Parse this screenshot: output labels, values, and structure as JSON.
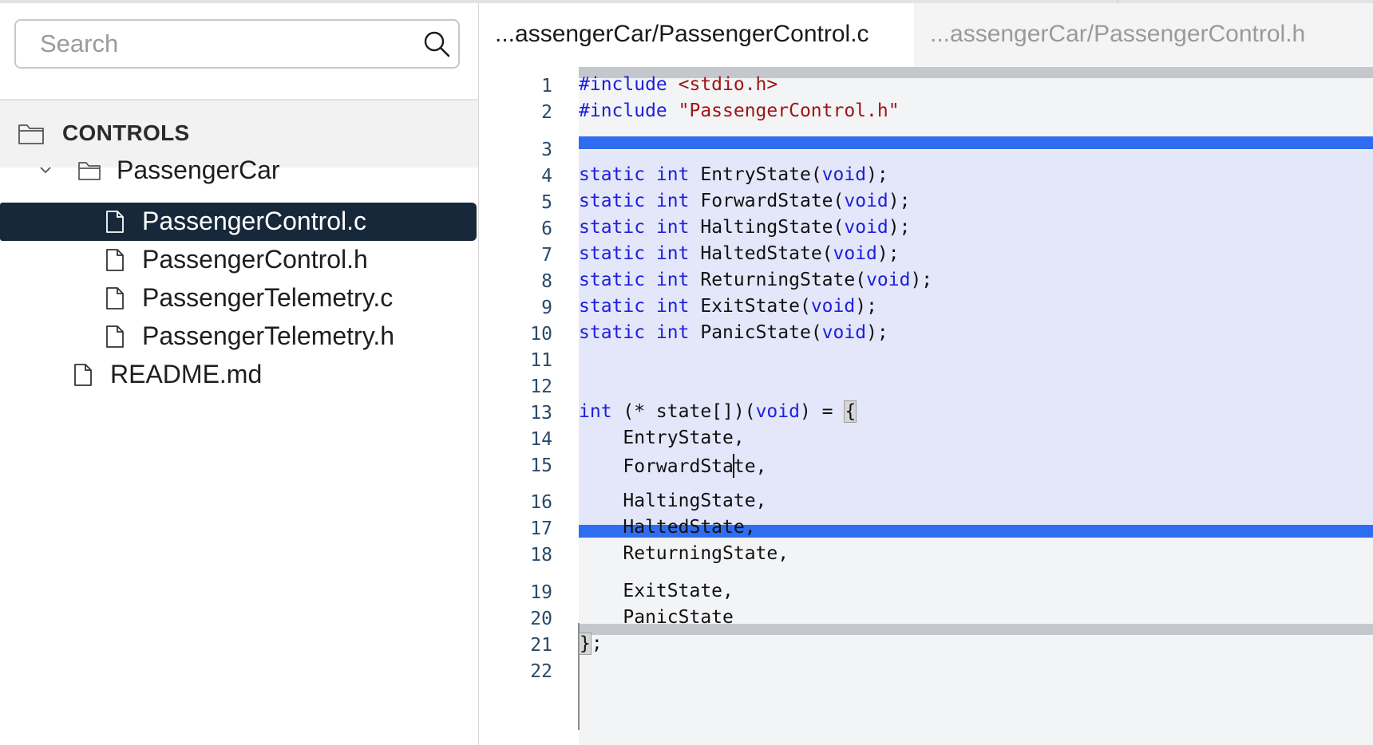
{
  "sidebar": {
    "search_placeholder": "Search",
    "root_label": "CONTROLS",
    "folder_label": "PassengerCar",
    "files": [
      "PassengerControl.c",
      "PassengerControl.h",
      "PassengerTelemetry.c",
      "PassengerTelemetry.h"
    ],
    "root_file": "README.md",
    "selected_file": "PassengerControl.c"
  },
  "tabs": [
    {
      "label": "...assengerCar/PassengerControl.c",
      "active": true
    },
    {
      "label": "...assengerCar/PassengerControl.h",
      "active": false
    }
  ],
  "editor": {
    "lines": [
      {
        "n": "1",
        "text": "#include <stdio.h>"
      },
      {
        "n": "2",
        "text": "#include \"PassengerControl.h\""
      },
      {
        "n": "3",
        "text": ""
      },
      {
        "n": "4",
        "text": "static int EntryState(void);"
      },
      {
        "n": "5",
        "text": "static int ForwardState(void);"
      },
      {
        "n": "6",
        "text": "static int HaltingState(void);"
      },
      {
        "n": "7",
        "text": "static int HaltedState(void);"
      },
      {
        "n": "8",
        "text": "static int ReturningState(void);"
      },
      {
        "n": "9",
        "text": "static int ExitState(void);"
      },
      {
        "n": "10",
        "text": "static int PanicState(void);"
      },
      {
        "n": "11",
        "text": ""
      },
      {
        "n": "12",
        "text": ""
      },
      {
        "n": "13",
        "text": "int (* state[])(void) = {"
      },
      {
        "n": "14",
        "text": "    EntryState,"
      },
      {
        "n": "15",
        "text": "    ForwardState,"
      },
      {
        "n": "16",
        "text": "    HaltingState,"
      },
      {
        "n": "17",
        "text": "    HaltedState,"
      },
      {
        "n": "18",
        "text": "    ReturningState,"
      },
      {
        "n": "19",
        "text": "    ExitState,"
      },
      {
        "n": "20",
        "text": "    PanicState"
      },
      {
        "n": "21",
        "text": "};"
      },
      {
        "n": "22",
        "text": ""
      }
    ],
    "colors": {
      "keyword": "#1d1fdc",
      "string": "#a01414",
      "selection_bar": "#2f6df0",
      "selection_bg": "#e4e7f9"
    }
  }
}
